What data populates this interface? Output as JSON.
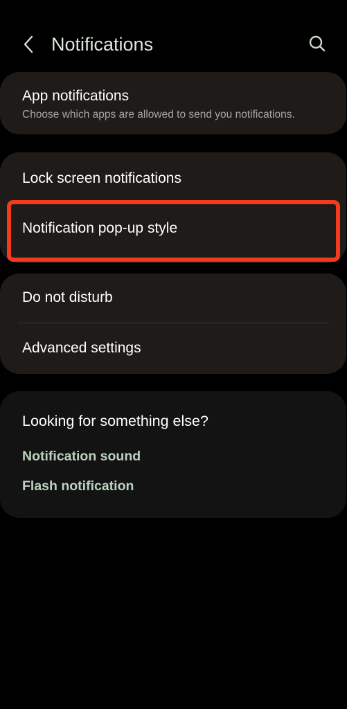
{
  "header": {
    "title": "Notifications",
    "back_icon": "chevron-left-icon",
    "search_icon": "search-icon",
    "title_color": "#dde7da"
  },
  "sections": {
    "app_notifications": {
      "title": "App notifications",
      "subtitle": "Choose which apps are allowed to send you notifications."
    },
    "lock_screen": {
      "title": "Lock screen notifications"
    },
    "popup_style": {
      "title": "Notification pop-up style",
      "highlight_color": "#f23a1e"
    },
    "do_not_disturb": {
      "title": "Do not disturb"
    },
    "advanced": {
      "title": "Advanced settings"
    }
  },
  "suggestions": {
    "heading": "Looking for something else?",
    "links": [
      "Notification sound",
      "Flash notification"
    ],
    "link_color": "#bcd2c0"
  }
}
